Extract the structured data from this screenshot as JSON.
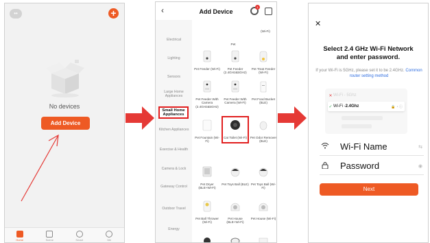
{
  "screen1": {
    "no_devices_text": "No devices",
    "add_device_button": "Add Device",
    "add_icon": "+",
    "home_icon": "home-pill-icon",
    "tabs": [
      {
        "label": "Home",
        "active": true
      },
      {
        "label": "Scene",
        "active": false
      },
      {
        "label": "Smart",
        "active": false
      },
      {
        "label": "Me",
        "active": false
      }
    ],
    "accent_color": "#ee5a24"
  },
  "screen2": {
    "title": "Add Device",
    "back_icon": "‹",
    "notification_count": "1",
    "categories": [
      {
        "label": "Electrical",
        "selected": false
      },
      {
        "label": "Lighting",
        "selected": false
      },
      {
        "label": "Sensors",
        "selected": false
      },
      {
        "label": "Large Home Appliances",
        "selected": false
      },
      {
        "label": "Small Home Appliances",
        "selected": true
      },
      {
        "label": "Kitchen Appliances",
        "selected": false
      },
      {
        "label": "Exercise & Health",
        "selected": false
      },
      {
        "label": "Camera & Lock",
        "selected": false
      },
      {
        "label": "Gateway Control",
        "selected": false
      },
      {
        "label": "Outdoor Travel",
        "selected": false
      },
      {
        "label": "Energy",
        "selected": false
      }
    ],
    "top_fragments": [
      "(Wi-Fi)",
      "Pet"
    ],
    "products": [
      {
        "name": "Pet Feeder (Wi-Fi)"
      },
      {
        "name": "Pet Feeder (2.4GHz&5GHz)"
      },
      {
        "name": "Pet Treat Feeder (Wi-Fi)"
      },
      {
        "name": "Pet Feeder With Camera (2.4GHz&5GHz)"
      },
      {
        "name": "Pet Feeder With Camera (Wi-Fi)"
      },
      {
        "name": "Pet Food Bucket (BLE)"
      },
      {
        "name": "Pet Fountain (Wi-Fi)"
      },
      {
        "name": "Cat Toilet (Wi-Fi)",
        "highlighted": true
      },
      {
        "name": "Pet Odor Remover (BLE)"
      },
      {
        "name": "Pet Dryer (BLE+Wi-Fi)"
      },
      {
        "name": "Pet Toys Ball (BLE)"
      },
      {
        "name": "Pet Toys Ball (Wi-Fi)"
      },
      {
        "name": "Pet Ball Thrower (Wi-Fi)"
      },
      {
        "name": "Pet House (BLE+Wi-Fi)"
      },
      {
        "name": "Pet House (Wi-Fi)"
      }
    ],
    "highlight_color": "#e11d1d"
  },
  "screen3": {
    "close_icon": "✕",
    "title_line1": "Select 2.4 GHz Wi-Fi Network",
    "title_line2": "and enter password.",
    "subtitle_plain": "If your Wi-Fi is 5GHz, please set it to be 2.4GHz.",
    "subtitle_link": "Common router setting method",
    "wifi_5g_label": "Wi-Fi - 5Ghz",
    "wifi_24_prefix": "Wi-Fi - ",
    "wifi_24_band": "2.4Ghz",
    "wifi_name_label": "Wi-Fi Name",
    "password_label": "Password",
    "next_button": "Next"
  }
}
